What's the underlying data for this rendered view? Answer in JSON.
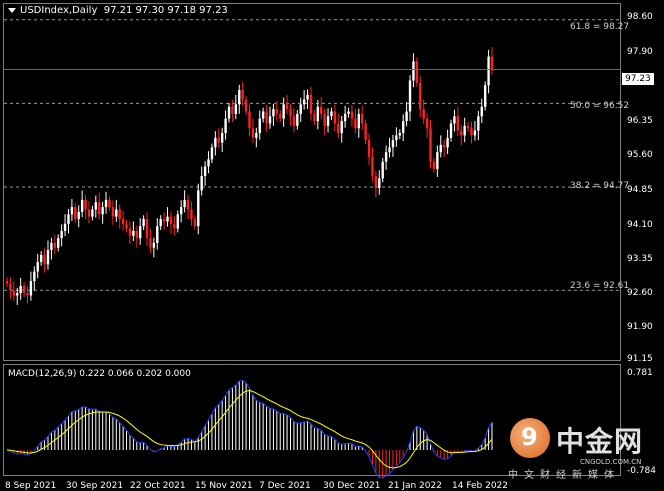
{
  "header": {
    "symbol": "USDIndex,Daily",
    "ohlc": "97.21 97.30 97.18 97.23"
  },
  "current_price": "97.23",
  "fib_levels": [
    {
      "label": "61.8 = 98.27",
      "value": 98.27
    },
    {
      "label": "50.0 = 96.52",
      "value": 96.52
    },
    {
      "label": "38.2 = 94.77",
      "value": 94.77
    },
    {
      "label": "23.6 = 92.61",
      "value": 92.61
    }
  ],
  "price_axis": [
    "98.60",
    "97.90",
    "97.23",
    "96.35",
    "95.60",
    "94.85",
    "94.10",
    "93.35",
    "92.60",
    "91.90",
    "91.15"
  ],
  "macd": {
    "title": "MACD(12,26,9) 0.222 0.066 0.202 0.000",
    "axis_top": "0.781",
    "axis_bottom": "-0.784"
  },
  "date_axis": [
    "8 Sep 2021",
    "30 Sep 2021",
    "22 Oct 2021",
    "15 Nov 2021",
    "7 Dec 2021",
    "30 Dec 2021",
    "21 Jan 2022",
    "14 Feb 2022"
  ],
  "watermark": {
    "brand": "中金网",
    "url": "CNGOLD.COM.CN",
    "tagline": "中文财经新媒体"
  },
  "colors": {
    "bull": "#ffffff",
    "bear": "#ff2020",
    "signal": "#ffff00",
    "macd_line": "#1e3cff",
    "grid_dash": "#9a9a9a"
  },
  "chart_data": {
    "type": "candlestick",
    "ylim": [
      91.15,
      98.6
    ],
    "closes": [
      92.75,
      92.6,
      92.5,
      92.55,
      92.7,
      92.55,
      92.5,
      92.8,
      93.0,
      93.2,
      93.35,
      93.15,
      93.45,
      93.6,
      93.5,
      93.7,
      93.85,
      94.0,
      94.2,
      94.35,
      94.1,
      94.25,
      94.5,
      94.3,
      94.15,
      94.3,
      94.45,
      94.2,
      94.35,
      94.5,
      94.35,
      94.15,
      94.3,
      94.1,
      94.0,
      93.9,
      93.75,
      93.85,
      93.7,
      93.95,
      94.1,
      93.7,
      93.5,
      93.6,
      93.95,
      94.1,
      94.05,
      94.15,
      94.0,
      93.9,
      94.2,
      94.35,
      94.5,
      94.3,
      94.1,
      93.95,
      94.7,
      95.0,
      95.2,
      95.35,
      95.6,
      95.8,
      95.7,
      95.9,
      96.2,
      96.45,
      96.3,
      96.5,
      96.8,
      96.6,
      96.35,
      96.0,
      95.8,
      95.9,
      96.2,
      96.35,
      96.1,
      96.25,
      96.4,
      96.3,
      96.2,
      96.5,
      96.4,
      96.25,
      96.05,
      96.3,
      96.5,
      96.6,
      96.7,
      96.3,
      96.15,
      96.45,
      96.3,
      96.05,
      96.25,
      96.35,
      96.1,
      95.9,
      96.15,
      96.3,
      96.35,
      96.2,
      96.0,
      96.3,
      96.1,
      95.75,
      95.4,
      95.0,
      94.75,
      94.95,
      95.3,
      95.5,
      95.6,
      95.75,
      95.85,
      95.9,
      96.15,
      96.35,
      97.0,
      97.4,
      96.95,
      96.4,
      96.2,
      96.0,
      95.3,
      95.15,
      95.5,
      95.65,
      95.6,
      95.8,
      96.1,
      96.25,
      95.95,
      95.85,
      96.05,
      96.0,
      95.85,
      95.95,
      96.25,
      96.45,
      96.9,
      97.5,
      97.23
    ]
  }
}
